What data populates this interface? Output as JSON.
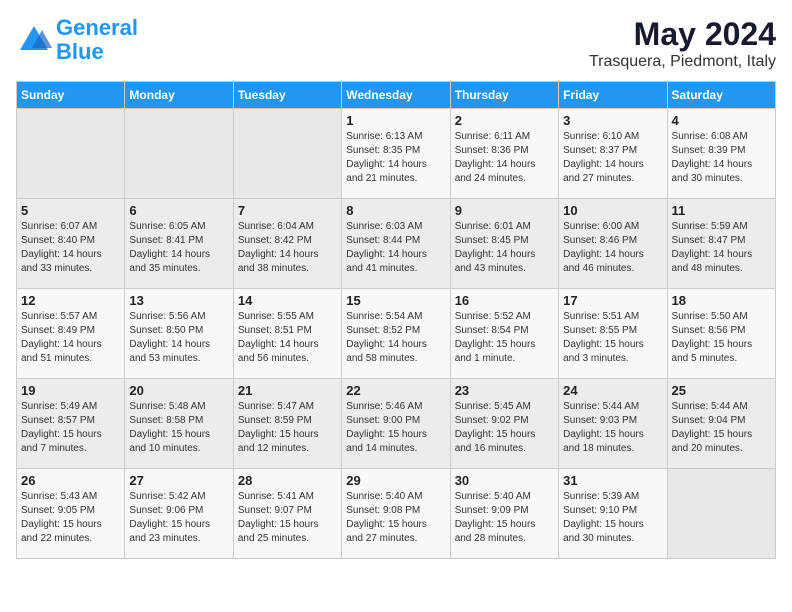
{
  "header": {
    "logo_line1": "General",
    "logo_line2": "Blue",
    "month_year": "May 2024",
    "location": "Trasquera, Piedmont, Italy"
  },
  "days_of_week": [
    "Sunday",
    "Monday",
    "Tuesday",
    "Wednesday",
    "Thursday",
    "Friday",
    "Saturday"
  ],
  "weeks": [
    [
      {
        "day": "",
        "info": ""
      },
      {
        "day": "",
        "info": ""
      },
      {
        "day": "",
        "info": ""
      },
      {
        "day": "1",
        "info": "Sunrise: 6:13 AM\nSunset: 8:35 PM\nDaylight: 14 hours\nand 21 minutes."
      },
      {
        "day": "2",
        "info": "Sunrise: 6:11 AM\nSunset: 8:36 PM\nDaylight: 14 hours\nand 24 minutes."
      },
      {
        "day": "3",
        "info": "Sunrise: 6:10 AM\nSunset: 8:37 PM\nDaylight: 14 hours\nand 27 minutes."
      },
      {
        "day": "4",
        "info": "Sunrise: 6:08 AM\nSunset: 8:39 PM\nDaylight: 14 hours\nand 30 minutes."
      }
    ],
    [
      {
        "day": "5",
        "info": "Sunrise: 6:07 AM\nSunset: 8:40 PM\nDaylight: 14 hours\nand 33 minutes."
      },
      {
        "day": "6",
        "info": "Sunrise: 6:05 AM\nSunset: 8:41 PM\nDaylight: 14 hours\nand 35 minutes."
      },
      {
        "day": "7",
        "info": "Sunrise: 6:04 AM\nSunset: 8:42 PM\nDaylight: 14 hours\nand 38 minutes."
      },
      {
        "day": "8",
        "info": "Sunrise: 6:03 AM\nSunset: 8:44 PM\nDaylight: 14 hours\nand 41 minutes."
      },
      {
        "day": "9",
        "info": "Sunrise: 6:01 AM\nSunset: 8:45 PM\nDaylight: 14 hours\nand 43 minutes."
      },
      {
        "day": "10",
        "info": "Sunrise: 6:00 AM\nSunset: 8:46 PM\nDaylight: 14 hours\nand 46 minutes."
      },
      {
        "day": "11",
        "info": "Sunrise: 5:59 AM\nSunset: 8:47 PM\nDaylight: 14 hours\nand 48 minutes."
      }
    ],
    [
      {
        "day": "12",
        "info": "Sunrise: 5:57 AM\nSunset: 8:49 PM\nDaylight: 14 hours\nand 51 minutes."
      },
      {
        "day": "13",
        "info": "Sunrise: 5:56 AM\nSunset: 8:50 PM\nDaylight: 14 hours\nand 53 minutes."
      },
      {
        "day": "14",
        "info": "Sunrise: 5:55 AM\nSunset: 8:51 PM\nDaylight: 14 hours\nand 56 minutes."
      },
      {
        "day": "15",
        "info": "Sunrise: 5:54 AM\nSunset: 8:52 PM\nDaylight: 14 hours\nand 58 minutes."
      },
      {
        "day": "16",
        "info": "Sunrise: 5:52 AM\nSunset: 8:54 PM\nDaylight: 15 hours\nand 1 minute."
      },
      {
        "day": "17",
        "info": "Sunrise: 5:51 AM\nSunset: 8:55 PM\nDaylight: 15 hours\nand 3 minutes."
      },
      {
        "day": "18",
        "info": "Sunrise: 5:50 AM\nSunset: 8:56 PM\nDaylight: 15 hours\nand 5 minutes."
      }
    ],
    [
      {
        "day": "19",
        "info": "Sunrise: 5:49 AM\nSunset: 8:57 PM\nDaylight: 15 hours\nand 7 minutes."
      },
      {
        "day": "20",
        "info": "Sunrise: 5:48 AM\nSunset: 8:58 PM\nDaylight: 15 hours\nand 10 minutes."
      },
      {
        "day": "21",
        "info": "Sunrise: 5:47 AM\nSunset: 8:59 PM\nDaylight: 15 hours\nand 12 minutes."
      },
      {
        "day": "22",
        "info": "Sunrise: 5:46 AM\nSunset: 9:00 PM\nDaylight: 15 hours\nand 14 minutes."
      },
      {
        "day": "23",
        "info": "Sunrise: 5:45 AM\nSunset: 9:02 PM\nDaylight: 15 hours\nand 16 minutes."
      },
      {
        "day": "24",
        "info": "Sunrise: 5:44 AM\nSunset: 9:03 PM\nDaylight: 15 hours\nand 18 minutes."
      },
      {
        "day": "25",
        "info": "Sunrise: 5:44 AM\nSunset: 9:04 PM\nDaylight: 15 hours\nand 20 minutes."
      }
    ],
    [
      {
        "day": "26",
        "info": "Sunrise: 5:43 AM\nSunset: 9:05 PM\nDaylight: 15 hours\nand 22 minutes."
      },
      {
        "day": "27",
        "info": "Sunrise: 5:42 AM\nSunset: 9:06 PM\nDaylight: 15 hours\nand 23 minutes."
      },
      {
        "day": "28",
        "info": "Sunrise: 5:41 AM\nSunset: 9:07 PM\nDaylight: 15 hours\nand 25 minutes."
      },
      {
        "day": "29",
        "info": "Sunrise: 5:40 AM\nSunset: 9:08 PM\nDaylight: 15 hours\nand 27 minutes."
      },
      {
        "day": "30",
        "info": "Sunrise: 5:40 AM\nSunset: 9:09 PM\nDaylight: 15 hours\nand 28 minutes."
      },
      {
        "day": "31",
        "info": "Sunrise: 5:39 AM\nSunset: 9:10 PM\nDaylight: 15 hours\nand 30 minutes."
      },
      {
        "day": "",
        "info": ""
      }
    ]
  ]
}
